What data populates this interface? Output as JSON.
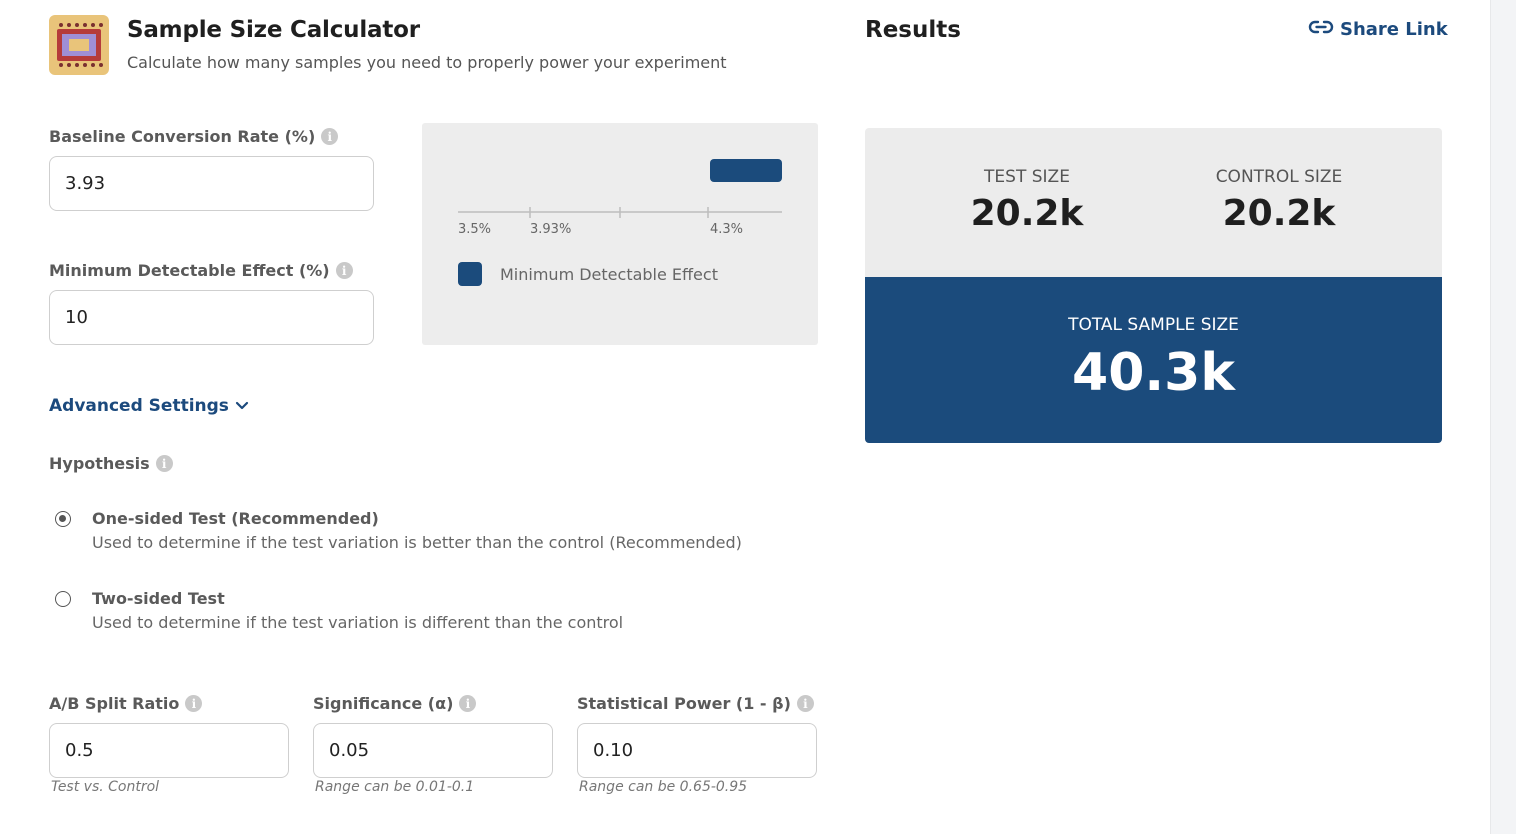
{
  "header": {
    "title": "Sample Size Calculator",
    "subtitle": "Calculate how many samples you need to properly power your experiment",
    "logo_icon": "calculator-people-icon"
  },
  "baseline": {
    "label": "Baseline Conversion Rate (%)",
    "value": "3.93",
    "info_icon": "info-icon"
  },
  "mde": {
    "label": "Minimum Detectable Effect (%)",
    "value": "10",
    "info_icon": "info-icon"
  },
  "chart": {
    "legend": "Minimum Detectable Effect",
    "tick_labels": [
      "3.5%",
      "3.93%",
      "4.3%"
    ],
    "accent_color": "#1b4b7c"
  },
  "advanced": {
    "label": "Advanced Settings",
    "icon": "chevron-down-icon"
  },
  "hypothesis": {
    "label": "Hypothesis",
    "options": [
      {
        "title": "One-sided Test (Recommended)",
        "description": "Used to determine if the test variation is better than the control (Recommended)",
        "checked": true
      },
      {
        "title": "Two-sided Test",
        "description": "Used to determine if the test variation is different than the control",
        "checked": false
      }
    ]
  },
  "split": {
    "label": "A/B Split Ratio",
    "value": "0.5",
    "hint": "Test vs. Control"
  },
  "significance": {
    "label": "Significance (α)",
    "value": "0.05",
    "hint": "Range can be 0.01-0.1"
  },
  "power": {
    "label": "Statistical Power (1 - β)",
    "value": "0.10",
    "hint": "Range can be 0.65-0.95"
  },
  "results": {
    "title": "Results",
    "share_label": "Share Link",
    "share_icon": "link-icon",
    "test_size_label": "TEST SIZE",
    "test_size_value": "20.2k",
    "control_size_label": "CONTROL SIZE",
    "control_size_value": "20.2k",
    "total_label": "TOTAL SAMPLE SIZE",
    "total_value": "40.3k"
  }
}
